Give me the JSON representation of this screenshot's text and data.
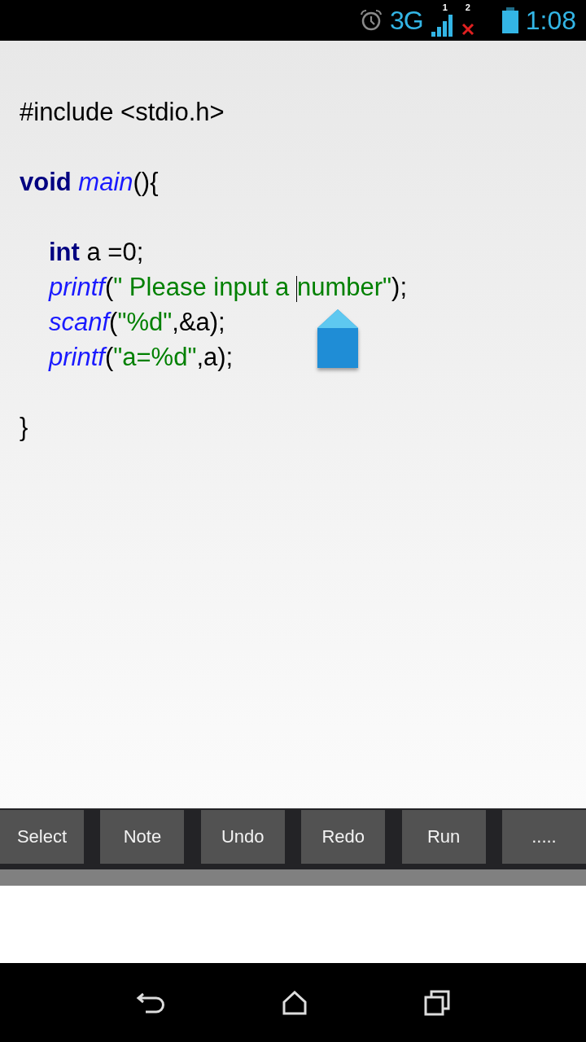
{
  "status_bar": {
    "network": "3G",
    "sim_1_label": "1",
    "sim_2_label": "2",
    "time": "1:08"
  },
  "code_lines": [
    {
      "kind": "code",
      "indented": false,
      "tokens": [
        {
          "kind": "plain",
          "text": "#include <stdio.h>"
        }
      ]
    },
    {
      "kind": "blank"
    },
    {
      "kind": "code",
      "indented": false,
      "tokens": [
        {
          "kind": "keyword",
          "text": "void "
        },
        {
          "kind": "function",
          "text": "main"
        },
        {
          "kind": "plain",
          "text": "(){"
        }
      ]
    },
    {
      "kind": "blank"
    },
    {
      "kind": "code",
      "indented": true,
      "tokens": [
        {
          "kind": "keyword",
          "text": "int"
        },
        {
          "kind": "plain",
          "text": " a =0;"
        }
      ]
    },
    {
      "kind": "code",
      "indented": true,
      "tokens": [
        {
          "kind": "function",
          "text": "printf"
        },
        {
          "kind": "plain",
          "text": "("
        },
        {
          "kind": "string",
          "text": "\" Please input a "
        },
        {
          "kind": "cursor"
        },
        {
          "kind": "string",
          "text": "number\""
        },
        {
          "kind": "plain",
          "text": ");"
        }
      ]
    },
    {
      "kind": "code",
      "indented": true,
      "tokens": [
        {
          "kind": "function",
          "text": "scanf"
        },
        {
          "kind": "plain",
          "text": "("
        },
        {
          "kind": "string",
          "text": "\"%d\""
        },
        {
          "kind": "plain",
          "text": ",&a);"
        }
      ]
    },
    {
      "kind": "code",
      "indented": true,
      "tokens": [
        {
          "kind": "function",
          "text": "printf"
        },
        {
          "kind": "plain",
          "text": "("
        },
        {
          "kind": "string",
          "text": "\"a=%d\""
        },
        {
          "kind": "plain",
          "text": ",a);"
        }
      ]
    },
    {
      "kind": "blank"
    },
    {
      "kind": "code",
      "indented": false,
      "tokens": [
        {
          "kind": "plain",
          "text": "}"
        }
      ]
    }
  ],
  "toolbar": [
    "Select",
    "Note",
    "Undo",
    "Redo",
    "Run",
    "....."
  ]
}
